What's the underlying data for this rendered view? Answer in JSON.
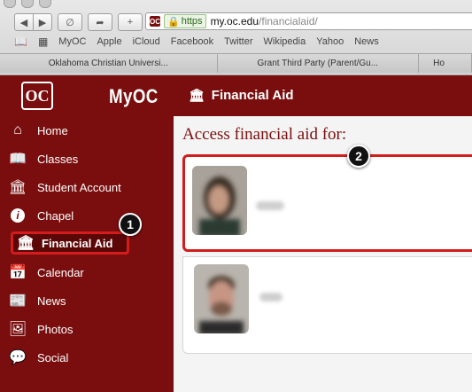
{
  "browser": {
    "url_secure_label": "https",
    "url_host": "my.oc.edu",
    "url_path": "/financialaid/",
    "bookmarks": [
      "MyOC",
      "Apple",
      "iCloud",
      "Facebook",
      "Twitter",
      "Wikipedia",
      "Yahoo",
      "News"
    ],
    "tabs": [
      "Oklahoma Christian Universi...",
      "Grant Third Party (Parent/Gu...",
      "Ho"
    ]
  },
  "header": {
    "logo_text": "OC",
    "brand": "MyOC",
    "page_title": "Financial Aid"
  },
  "sidebar": {
    "items": [
      {
        "label": "Home",
        "icon": "home-icon"
      },
      {
        "label": "Classes",
        "icon": "book-icon"
      },
      {
        "label": "Student Account",
        "icon": "bank-icon"
      },
      {
        "label": "Chapel",
        "icon": "info-icon"
      },
      {
        "label": "Financial Aid",
        "icon": "bank-icon",
        "active": true
      },
      {
        "label": "Calendar",
        "icon": "calendar-icon"
      },
      {
        "label": "News",
        "icon": "newspaper-icon"
      },
      {
        "label": "Photos",
        "icon": "photo-icon"
      },
      {
        "label": "Social",
        "icon": "chat-icon"
      }
    ]
  },
  "main": {
    "heading": "Access financial aid for:"
  },
  "callouts": [
    "1",
    "2"
  ],
  "colors": {
    "brand_maroon": "#7a0e0e",
    "highlight_red": "#d31c1c"
  }
}
